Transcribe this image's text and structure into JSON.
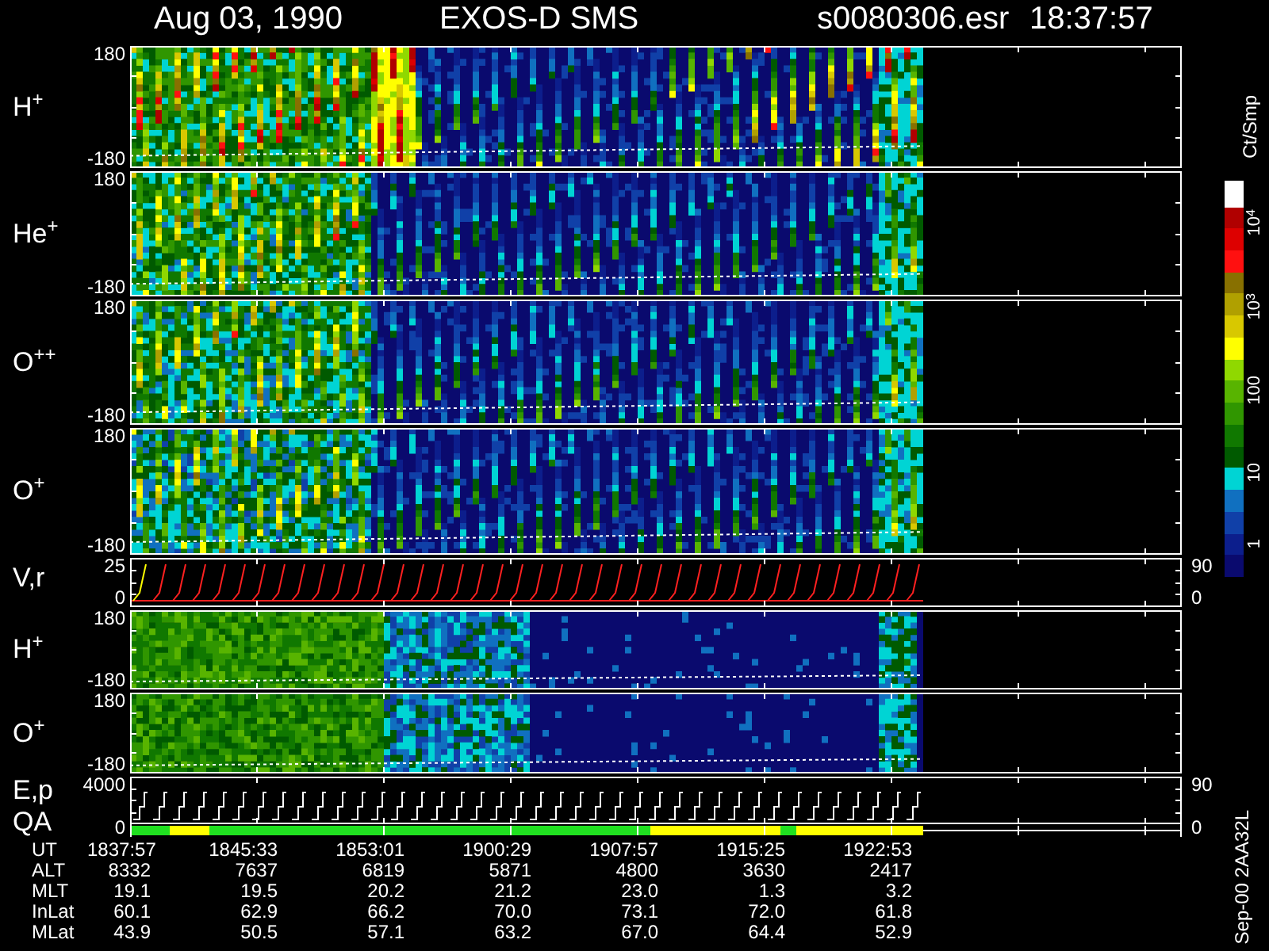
{
  "header": {
    "date": "Aug 03, 1990",
    "title": "EXOS-D SMS",
    "file": "s0080306.esr",
    "time": "18:37:57"
  },
  "panels": [
    {
      "kind": "spectrogram",
      "labels": [
        "H$^{+}$"
      ],
      "left_ticks": [
        "180",
        "-180"
      ]
    },
    {
      "kind": "spectrogram",
      "labels": [
        "He$^{+}$"
      ],
      "left_ticks": [
        "180",
        "-180"
      ]
    },
    {
      "kind": "spectrogram",
      "labels": [
        "O$^{++}$"
      ],
      "left_ticks": [
        "180",
        "-180"
      ]
    },
    {
      "kind": "spectrogram",
      "labels": [
        "O$^{+}$"
      ],
      "left_ticks": [
        "180",
        "-180"
      ]
    },
    {
      "kind": "line-plot",
      "labels": [
        "V,r"
      ],
      "left_ticks": [
        "25",
        "0"
      ],
      "right_ticks": [
        "90",
        "0"
      ]
    },
    {
      "kind": "spectrogram",
      "labels": [
        "H$^{+}$"
      ],
      "left_ticks": [
        "180",
        "-180"
      ]
    },
    {
      "kind": "spectrogram",
      "labels": [
        "O$^{+}$"
      ],
      "left_ticks": [
        "180",
        "-180"
      ]
    },
    {
      "kind": "step-plot",
      "labels": [
        "E,p",
        "QA"
      ],
      "left_ticks": [
        "4000",
        "0"
      ],
      "right_ticks": [
        "90",
        "0"
      ]
    }
  ],
  "legend": {
    "unit": "Ct/Smp",
    "ticks": [
      "10$^{4}$",
      "10$^{3}$",
      "100",
      "10",
      "1"
    ]
  },
  "ephemeris": [
    {
      "label": "UT",
      "values": [
        "1837:57",
        "1845:33",
        "1853:01",
        "1900:29",
        "1907:57",
        "1915:25",
        "1922:53"
      ]
    },
    {
      "label": "ALT",
      "values": [
        "8332",
        "7637",
        "6819",
        "5871",
        "4800",
        "3630",
        "2417"
      ]
    },
    {
      "label": "MLT",
      "values": [
        "19.1",
        "19.5",
        "20.2",
        "21.2",
        "23.0",
        "1.3",
        "3.2"
      ]
    },
    {
      "label": "InLat",
      "values": [
        "60.1",
        "62.9",
        "66.2",
        "70.0",
        "73.1",
        "72.0",
        "61.8"
      ]
    },
    {
      "label": "MLat",
      "values": [
        "43.9",
        "50.5",
        "57.1",
        "63.2",
        "67.0",
        "64.4",
        "52.9"
      ]
    }
  ],
  "footer": "Sep-00 2AA32L"
}
